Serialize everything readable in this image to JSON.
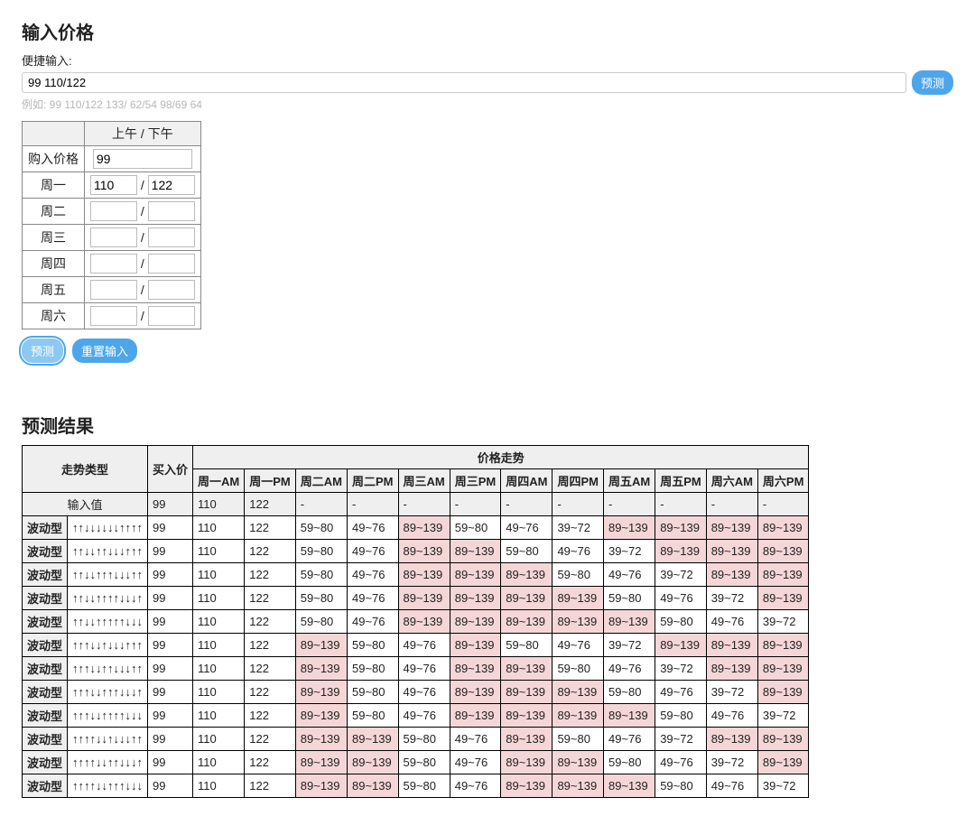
{
  "input": {
    "title": "输入价格",
    "quick_label": "便捷输入:",
    "quick_value": "99 110/122",
    "predict_btn": "预测",
    "example": "例如: 99 110/122 133/ 62/54 98/69 64",
    "col_header": "上午 / 下午",
    "row_buy_label": "购入价格",
    "buy_value": "99",
    "days": [
      {
        "label": "周一",
        "am": "110",
        "pm": "122"
      },
      {
        "label": "周二",
        "am": "",
        "pm": ""
      },
      {
        "label": "周三",
        "am": "",
        "pm": ""
      },
      {
        "label": "周四",
        "am": "",
        "pm": ""
      },
      {
        "label": "周五",
        "am": "",
        "pm": ""
      },
      {
        "label": "周六",
        "am": "",
        "pm": ""
      }
    ],
    "predict_btn2": "预测",
    "reset_btn": "重置输入"
  },
  "result": {
    "title": "预测结果",
    "header": {
      "trend_type": "走势类型",
      "buy_price": "买入价",
      "price_trend": "价格走势",
      "cols": [
        "周一AM",
        "周一PM",
        "周二AM",
        "周二PM",
        "周三AM",
        "周三PM",
        "周四AM",
        "周四PM",
        "周五AM",
        "周五PM",
        "周六AM",
        "周六PM"
      ]
    },
    "input_row": {
      "label": "输入值",
      "buy": "99",
      "cells": [
        "110",
        "122",
        "-",
        "-",
        "-",
        "-",
        "-",
        "-",
        "-",
        "-",
        "-",
        "-"
      ]
    },
    "rows": [
      {
        "type": "波动型",
        "arrows": "↑↑↓↓↓↓↓↓↑↑↑↑",
        "buy": "99",
        "cells": [
          {
            "v": "110"
          },
          {
            "v": "122"
          },
          {
            "v": "59~80"
          },
          {
            "v": "49~76"
          },
          {
            "v": "89~139",
            "hi": true
          },
          {
            "v": "59~80"
          },
          {
            "v": "49~76"
          },
          {
            "v": "39~72"
          },
          {
            "v": "89~139",
            "hi": true
          },
          {
            "v": "89~139",
            "hi": true
          },
          {
            "v": "89~139",
            "hi": true
          },
          {
            "v": "89~139",
            "hi": true
          }
        ]
      },
      {
        "type": "波动型",
        "arrows": "↑↑↓↓↑↑↓↓↓↑↑↑",
        "buy": "99",
        "cells": [
          {
            "v": "110"
          },
          {
            "v": "122"
          },
          {
            "v": "59~80"
          },
          {
            "v": "49~76"
          },
          {
            "v": "89~139",
            "hi": true
          },
          {
            "v": "89~139",
            "hi": true
          },
          {
            "v": "59~80"
          },
          {
            "v": "49~76"
          },
          {
            "v": "39~72"
          },
          {
            "v": "89~139",
            "hi": true
          },
          {
            "v": "89~139",
            "hi": true
          },
          {
            "v": "89~139",
            "hi": true
          }
        ]
      },
      {
        "type": "波动型",
        "arrows": "↑↑↓↓↑↑↑↓↓↓↑↑",
        "buy": "99",
        "cells": [
          {
            "v": "110"
          },
          {
            "v": "122"
          },
          {
            "v": "59~80"
          },
          {
            "v": "49~76"
          },
          {
            "v": "89~139",
            "hi": true
          },
          {
            "v": "89~139",
            "hi": true
          },
          {
            "v": "89~139",
            "hi": true
          },
          {
            "v": "59~80"
          },
          {
            "v": "49~76"
          },
          {
            "v": "39~72"
          },
          {
            "v": "89~139",
            "hi": true
          },
          {
            "v": "89~139",
            "hi": true
          }
        ]
      },
      {
        "type": "波动型",
        "arrows": "↑↑↓↓↑↑↑↑↓↓↓↑",
        "buy": "99",
        "cells": [
          {
            "v": "110"
          },
          {
            "v": "122"
          },
          {
            "v": "59~80"
          },
          {
            "v": "49~76"
          },
          {
            "v": "89~139",
            "hi": true
          },
          {
            "v": "89~139",
            "hi": true
          },
          {
            "v": "89~139",
            "hi": true
          },
          {
            "v": "89~139",
            "hi": true
          },
          {
            "v": "59~80"
          },
          {
            "v": "49~76"
          },
          {
            "v": "39~72"
          },
          {
            "v": "89~139",
            "hi": true
          }
        ]
      },
      {
        "type": "波动型",
        "arrows": "↑↑↓↓↑↑↑↑↑↓↓↓",
        "buy": "99",
        "cells": [
          {
            "v": "110"
          },
          {
            "v": "122"
          },
          {
            "v": "59~80"
          },
          {
            "v": "49~76"
          },
          {
            "v": "89~139",
            "hi": true
          },
          {
            "v": "89~139",
            "hi": true
          },
          {
            "v": "89~139",
            "hi": true
          },
          {
            "v": "89~139",
            "hi": true
          },
          {
            "v": "89~139",
            "hi": true
          },
          {
            "v": "59~80"
          },
          {
            "v": "49~76"
          },
          {
            "v": "39~72"
          }
        ]
      },
      {
        "type": "波动型",
        "arrows": "↑↑↑↓↓↑↓↓↓↑↑↑",
        "buy": "99",
        "cells": [
          {
            "v": "110"
          },
          {
            "v": "122"
          },
          {
            "v": "89~139",
            "hi": true
          },
          {
            "v": "59~80"
          },
          {
            "v": "49~76"
          },
          {
            "v": "89~139",
            "hi": true
          },
          {
            "v": "59~80"
          },
          {
            "v": "49~76"
          },
          {
            "v": "39~72"
          },
          {
            "v": "89~139",
            "hi": true
          },
          {
            "v": "89~139",
            "hi": true
          },
          {
            "v": "89~139",
            "hi": true
          }
        ]
      },
      {
        "type": "波动型",
        "arrows": "↑↑↑↓↓↑↑↓↓↓↑↑",
        "buy": "99",
        "cells": [
          {
            "v": "110"
          },
          {
            "v": "122"
          },
          {
            "v": "89~139",
            "hi": true
          },
          {
            "v": "59~80"
          },
          {
            "v": "49~76"
          },
          {
            "v": "89~139",
            "hi": true
          },
          {
            "v": "89~139",
            "hi": true
          },
          {
            "v": "59~80"
          },
          {
            "v": "49~76"
          },
          {
            "v": "39~72"
          },
          {
            "v": "89~139",
            "hi": true
          },
          {
            "v": "89~139",
            "hi": true
          }
        ]
      },
      {
        "type": "波动型",
        "arrows": "↑↑↑↓↓↑↑↑↓↓↓↑",
        "buy": "99",
        "cells": [
          {
            "v": "110"
          },
          {
            "v": "122"
          },
          {
            "v": "89~139",
            "hi": true
          },
          {
            "v": "59~80"
          },
          {
            "v": "49~76"
          },
          {
            "v": "89~139",
            "hi": true
          },
          {
            "v": "89~139",
            "hi": true
          },
          {
            "v": "89~139",
            "hi": true
          },
          {
            "v": "59~80"
          },
          {
            "v": "49~76"
          },
          {
            "v": "39~72"
          },
          {
            "v": "89~139",
            "hi": true
          }
        ]
      },
      {
        "type": "波动型",
        "arrows": "↑↑↑↓↓↑↑↑↑↓↓↓",
        "buy": "99",
        "cells": [
          {
            "v": "110"
          },
          {
            "v": "122"
          },
          {
            "v": "89~139",
            "hi": true
          },
          {
            "v": "59~80"
          },
          {
            "v": "49~76"
          },
          {
            "v": "89~139",
            "hi": true
          },
          {
            "v": "89~139",
            "hi": true
          },
          {
            "v": "89~139",
            "hi": true
          },
          {
            "v": "89~139",
            "hi": true
          },
          {
            "v": "59~80"
          },
          {
            "v": "49~76"
          },
          {
            "v": "39~72"
          }
        ]
      },
      {
        "type": "波动型",
        "arrows": "↑↑↑↑↓↓↑↓↓↓↑↑",
        "buy": "99",
        "cells": [
          {
            "v": "110"
          },
          {
            "v": "122"
          },
          {
            "v": "89~139",
            "hi": true
          },
          {
            "v": "89~139",
            "hi": true
          },
          {
            "v": "59~80"
          },
          {
            "v": "49~76"
          },
          {
            "v": "89~139",
            "hi": true
          },
          {
            "v": "59~80"
          },
          {
            "v": "49~76"
          },
          {
            "v": "39~72"
          },
          {
            "v": "89~139",
            "hi": true
          },
          {
            "v": "89~139",
            "hi": true
          }
        ]
      },
      {
        "type": "波动型",
        "arrows": "↑↑↑↑↓↓↑↑↓↓↓↑",
        "buy": "99",
        "cells": [
          {
            "v": "110"
          },
          {
            "v": "122"
          },
          {
            "v": "89~139",
            "hi": true
          },
          {
            "v": "89~139",
            "hi": true
          },
          {
            "v": "59~80"
          },
          {
            "v": "49~76"
          },
          {
            "v": "89~139",
            "hi": true
          },
          {
            "v": "89~139",
            "hi": true
          },
          {
            "v": "59~80"
          },
          {
            "v": "49~76"
          },
          {
            "v": "39~72"
          },
          {
            "v": "89~139",
            "hi": true
          }
        ]
      },
      {
        "type": "波动型",
        "arrows": "↑↑↑↑↓↓↑↑↑↓↓↓",
        "buy": "99",
        "cells": [
          {
            "v": "110"
          },
          {
            "v": "122"
          },
          {
            "v": "89~139",
            "hi": true
          },
          {
            "v": "89~139",
            "hi": true
          },
          {
            "v": "59~80"
          },
          {
            "v": "49~76"
          },
          {
            "v": "89~139",
            "hi": true
          },
          {
            "v": "89~139",
            "hi": true
          },
          {
            "v": "89~139",
            "hi": true
          },
          {
            "v": "59~80"
          },
          {
            "v": "49~76"
          },
          {
            "v": "39~72"
          }
        ]
      }
    ]
  }
}
